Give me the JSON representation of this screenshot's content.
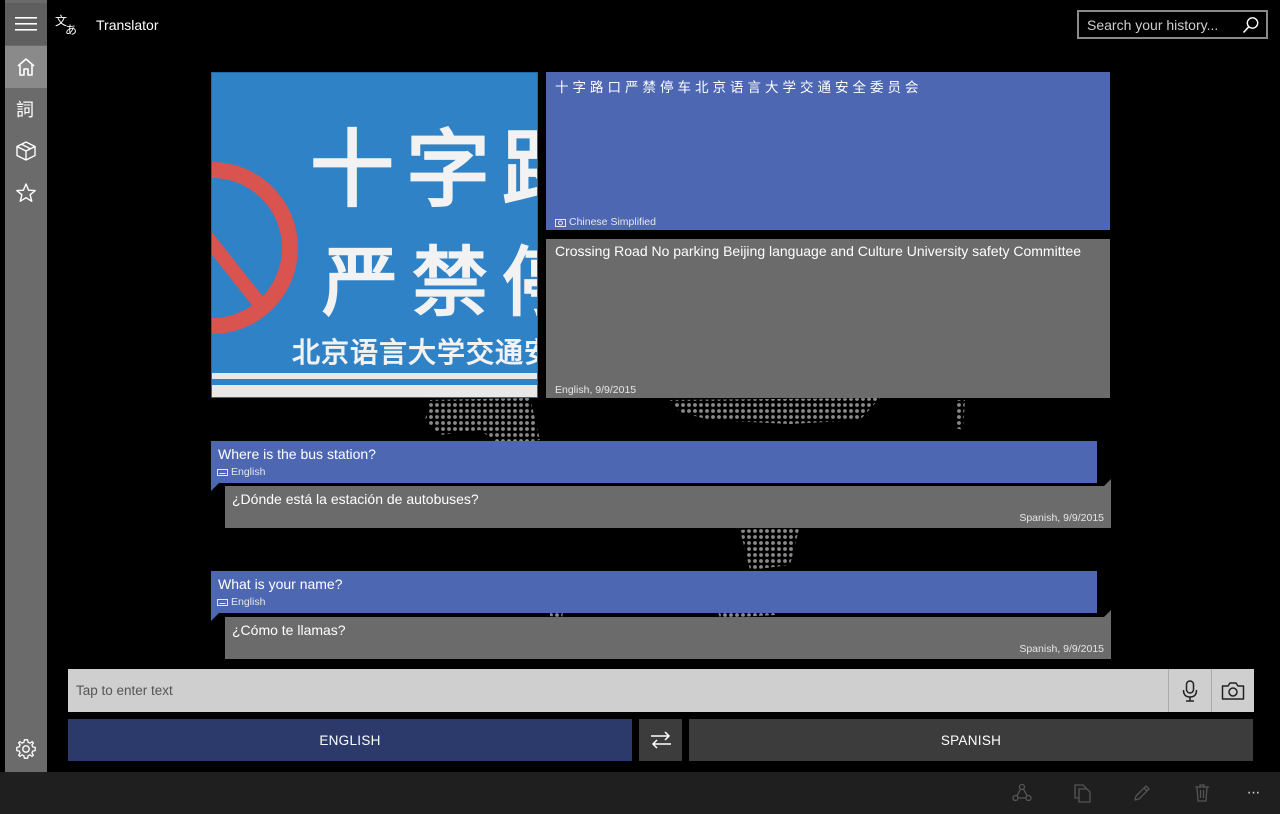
{
  "app": {
    "title": "Translator"
  },
  "search": {
    "placeholder": "Search your history..."
  },
  "nav": {
    "items": [
      {
        "icon": "hamburger-menu-icon"
      },
      {
        "icon": "home-icon",
        "selected": true
      },
      {
        "icon": "phrasebook-icon"
      },
      {
        "icon": "language-packs-icon"
      },
      {
        "icon": "favorites-star-icon"
      },
      {
        "icon": "settings-gear-icon"
      }
    ]
  },
  "image_translation": {
    "photo_text_line1": "十字路",
    "photo_text_line2": "严禁停",
    "photo_text_line3": "北京语言大学交通安",
    "source_text": "十字路口严禁停车北京语言大学交通安全委员会",
    "source_meta": "Chinese Simplified",
    "translated_text": "Crossing Road No parking Beijing language and Culture University safety Committee",
    "translated_meta": "English, 9/9/2015"
  },
  "conversations": [
    {
      "question": "Where is the bus station?",
      "question_meta": "English",
      "answer": "¿Dónde está la estación de autobuses?",
      "answer_meta": "Spanish, 9/9/2015"
    },
    {
      "question": "What is your name?",
      "question_meta": "English",
      "answer": "¿Cómo te llamas?",
      "answer_meta": "Spanish, 9/9/2015"
    }
  ],
  "input": {
    "placeholder": "Tap to enter text"
  },
  "languages": {
    "from": "ENGLISH",
    "to": "SPANISH"
  },
  "appbar": {
    "icons": [
      "share-icon",
      "copy-icon",
      "edit-pencil-icon",
      "delete-trash-icon",
      "more-ellipsis-icon"
    ],
    "more_label": "···"
  },
  "colors": {
    "accent_blue": "#4e67b3",
    "card_gray": "#6b6b6b",
    "lang_from_bg": "#2b3a6b"
  }
}
